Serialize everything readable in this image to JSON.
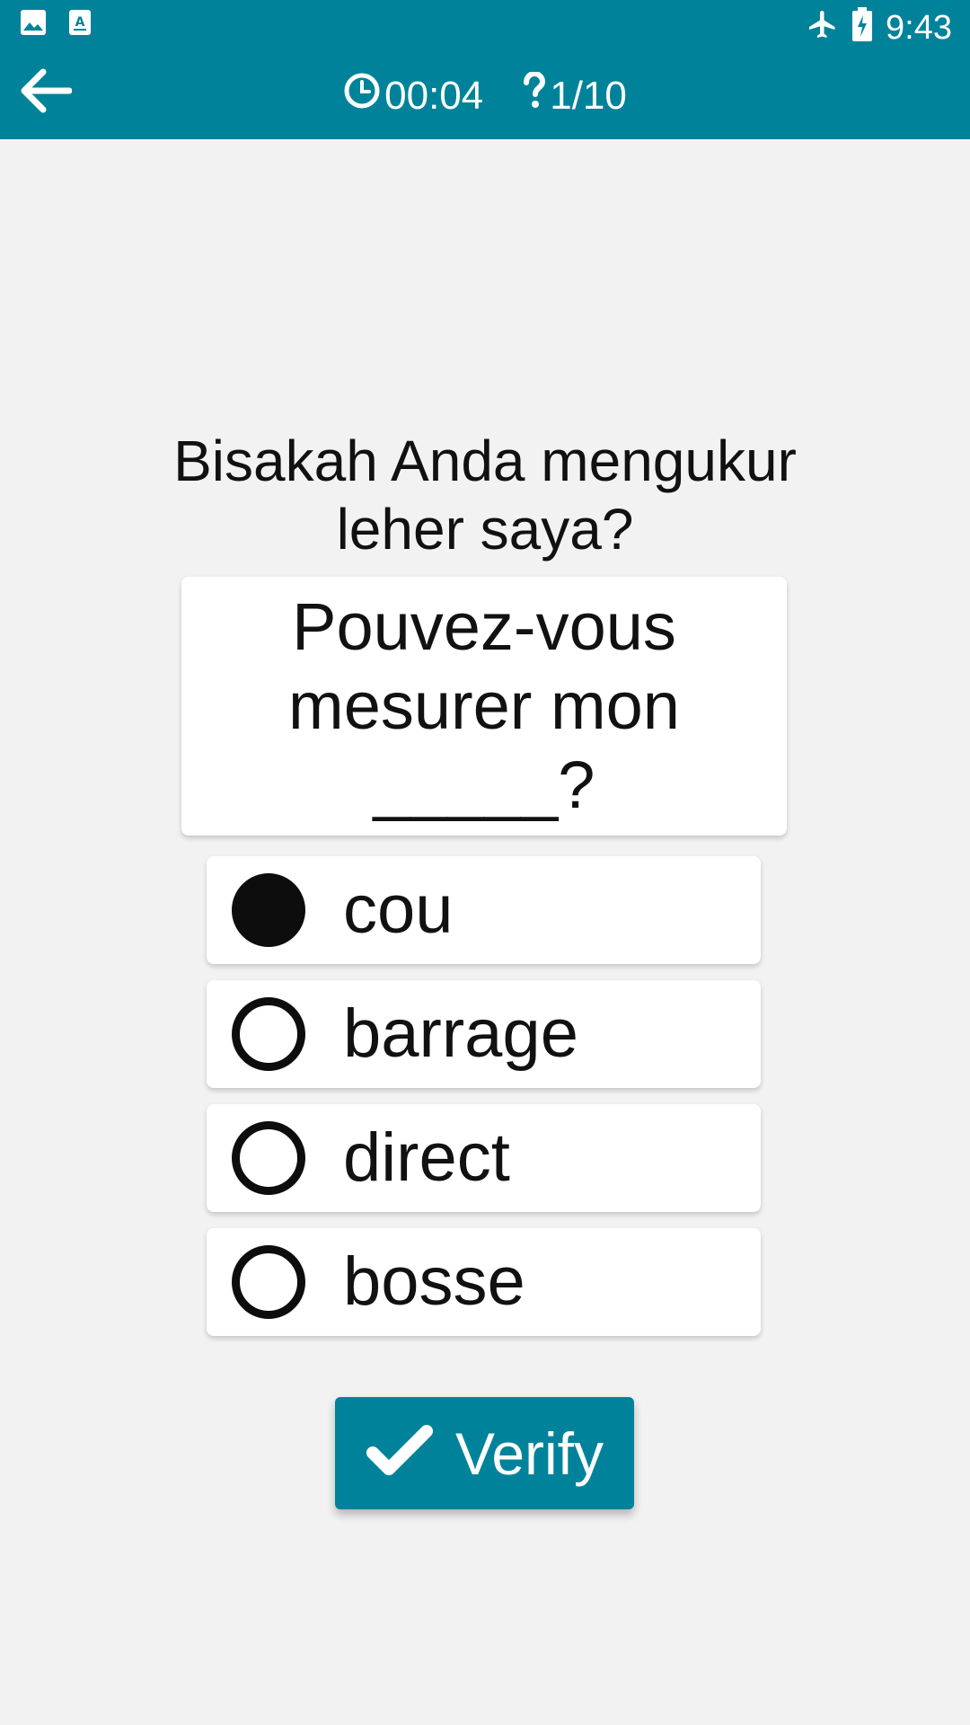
{
  "status_bar": {
    "time": "9:43",
    "icons": [
      "image-icon",
      "app-store-icon",
      "airplane-mode-icon",
      "battery-charging-icon"
    ]
  },
  "toolbar": {
    "timer": "00:04",
    "progress": "1/10",
    "icons": [
      "back-arrow-icon",
      "clock-icon",
      "question-mark-icon"
    ]
  },
  "quiz": {
    "question": "Bisakah Anda mengukur leher saya?",
    "prompt": "Pouvez-vous mesurer mon _____?",
    "options": [
      {
        "label": "cou",
        "selected": true
      },
      {
        "label": "barrage",
        "selected": false
      },
      {
        "label": "direct",
        "selected": false
      },
      {
        "label": "bosse",
        "selected": false
      }
    ]
  },
  "verify_button": {
    "label": "Verify",
    "icon": "checkmark-icon"
  },
  "colors": {
    "primary": "#00839a",
    "background": "#f2f2f2",
    "card": "#ffffff",
    "text": "#111111"
  }
}
